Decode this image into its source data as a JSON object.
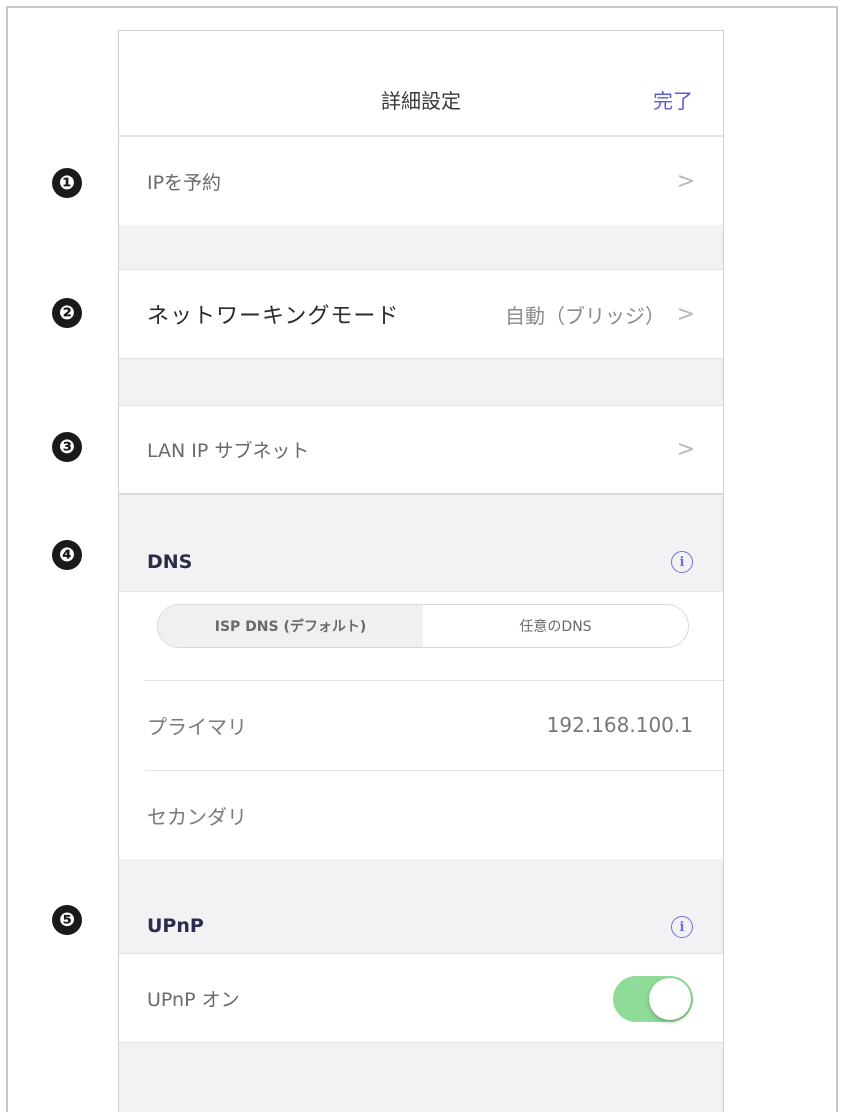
{
  "header": {
    "title": "詳細設定",
    "done_label": "完了"
  },
  "badges": [
    "❶",
    "❷",
    "❸",
    "❹",
    "❺"
  ],
  "rows": {
    "reserve_ip": {
      "label": "IPを予約"
    },
    "networking_mode": {
      "label": "ネットワーキングモード",
      "value": "自動（ブリッジ）"
    },
    "lan_subnet": {
      "label": "LAN IP サブネット"
    }
  },
  "dns": {
    "title": "DNS",
    "info_icon": "info-icon",
    "segments": [
      "ISP DNS (デフォルト)",
      "任意のDNS"
    ],
    "selected_segment": "ISP DNS (デフォルト)",
    "primary_label": "プライマリ",
    "primary_value": "192.168.100.1",
    "secondary_label": "セカンダリ"
  },
  "upnp": {
    "title": "UPnP",
    "info_icon": "info-icon",
    "toggle_label": "UPnP オン",
    "toggle_on": true
  },
  "colors": {
    "accent": "#5a5bd6",
    "toggle_on": "#8edc98",
    "background": "#f2f2f5"
  },
  "icons": {
    "chevron": "chevron-right-icon",
    "info": "info-icon"
  }
}
